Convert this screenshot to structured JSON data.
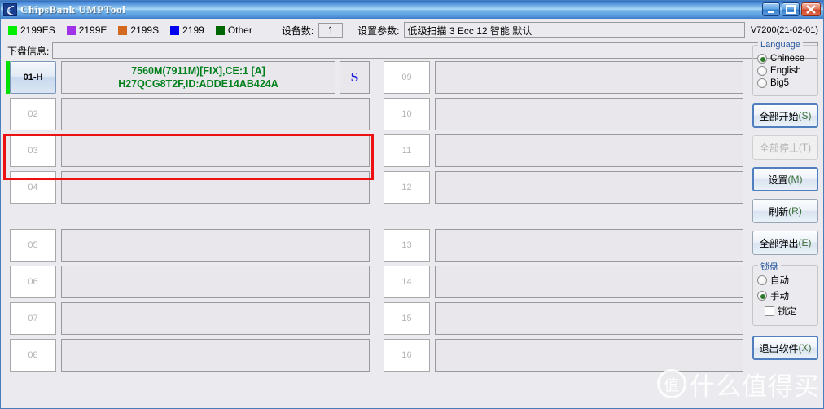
{
  "window": {
    "title": "ChipsBank UMPTool",
    "icon": "app-icon",
    "minimize_label": "–",
    "maximize_label": "□",
    "close_label": "✕"
  },
  "legend": {
    "items": [
      {
        "label": "2199ES",
        "color": "#00ee00"
      },
      {
        "label": "2199E",
        "color": "#a033e8"
      },
      {
        "label": "2199S",
        "color": "#d2691e"
      },
      {
        "label": "2199",
        "color": "#0000ee"
      },
      {
        "label": "Other",
        "color": "#006600"
      }
    ]
  },
  "toolbar": {
    "device_count_label": "设备数:",
    "device_count_value": "1",
    "set_param_label": "设置参数:",
    "set_param_value": "低级扫描 3 Ecc 12 智能 默认",
    "version": "V7200(21-02-01)"
  },
  "infobar": {
    "label": "下盘信息:",
    "value": ""
  },
  "slots": {
    "left": [
      {
        "id": "01-H",
        "active": true,
        "status_color": "#00e000",
        "line1": "7560M(7911M)[FIX],CE:1 [A]",
        "line2": "H27QCG8T2F,ID:ADDE14AB424A",
        "badge": "S",
        "highlight": true,
        "gap": false
      },
      {
        "id": "02",
        "active": false,
        "line1": "",
        "line2": "",
        "badge": "",
        "highlight": false,
        "gap": false
      },
      {
        "id": "03",
        "active": false,
        "line1": "",
        "line2": "",
        "badge": "",
        "highlight": false,
        "gap": false
      },
      {
        "id": "04",
        "active": false,
        "line1": "",
        "line2": "",
        "badge": "",
        "highlight": false,
        "gap": false
      },
      {
        "id": "05",
        "active": false,
        "line1": "",
        "line2": "",
        "badge": "",
        "highlight": false,
        "gap": true
      },
      {
        "id": "06",
        "active": false,
        "line1": "",
        "line2": "",
        "badge": "",
        "highlight": false,
        "gap": false
      },
      {
        "id": "07",
        "active": false,
        "line1": "",
        "line2": "",
        "badge": "",
        "highlight": false,
        "gap": false
      },
      {
        "id": "08",
        "active": false,
        "line1": "",
        "line2": "",
        "badge": "",
        "highlight": false,
        "gap": false
      }
    ],
    "right": [
      {
        "id": "09",
        "active": false,
        "line1": "",
        "line2": "",
        "badge": "",
        "highlight": false,
        "gap": false
      },
      {
        "id": "10",
        "active": false,
        "line1": "",
        "line2": "",
        "badge": "",
        "highlight": false,
        "gap": false
      },
      {
        "id": "11",
        "active": false,
        "line1": "",
        "line2": "",
        "badge": "",
        "highlight": false,
        "gap": false
      },
      {
        "id": "12",
        "active": false,
        "line1": "",
        "line2": "",
        "badge": "",
        "highlight": false,
        "gap": false
      },
      {
        "id": "13",
        "active": false,
        "line1": "",
        "line2": "",
        "badge": "",
        "highlight": false,
        "gap": true
      },
      {
        "id": "14",
        "active": false,
        "line1": "",
        "line2": "",
        "badge": "",
        "highlight": false,
        "gap": false
      },
      {
        "id": "15",
        "active": false,
        "line1": "",
        "line2": "",
        "badge": "",
        "highlight": false,
        "gap": false
      },
      {
        "id": "16",
        "active": false,
        "line1": "",
        "line2": "",
        "badge": "",
        "highlight": false,
        "gap": false
      }
    ]
  },
  "sidebar": {
    "language_group": {
      "title": "Language",
      "options": [
        {
          "label": "Chinese",
          "selected": true
        },
        {
          "label": "English",
          "selected": false
        },
        {
          "label": "Big5",
          "selected": false
        }
      ]
    },
    "buttons": [
      {
        "label": "全部开始",
        "mnemonic": "(S)",
        "state": "primary",
        "name": "start-all-button"
      },
      {
        "label": "全部停止",
        "mnemonic": "(T)",
        "state": "disabled",
        "name": "stop-all-button"
      },
      {
        "label": "设置",
        "mnemonic": "(M)",
        "state": "primary",
        "name": "settings-button"
      },
      {
        "label": "刷新",
        "mnemonic": "(R)",
        "state": "normal",
        "name": "refresh-button"
      },
      {
        "label": "全部弹出",
        "mnemonic": "(E)",
        "state": "normal",
        "name": "eject-all-button"
      }
    ],
    "lock_group": {
      "title": "锁盘",
      "options": [
        {
          "label": "自动",
          "selected": false
        },
        {
          "label": "手动",
          "selected": true
        }
      ],
      "checkbox": {
        "label": "锁定",
        "checked": false
      }
    },
    "exit_button": {
      "label": "退出软件",
      "mnemonic": "(X)",
      "name": "exit-button"
    }
  },
  "watermark": {
    "logo_char": "值",
    "text": "什么值得买"
  }
}
